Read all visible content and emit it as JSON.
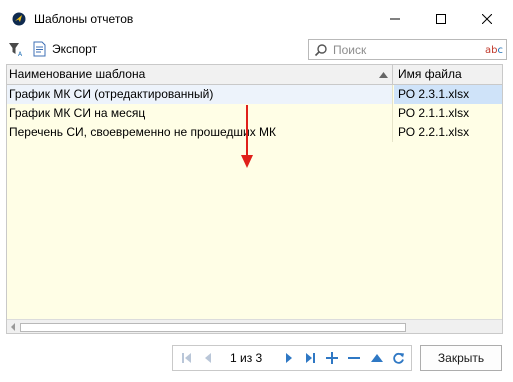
{
  "window": {
    "title": "Шаблоны отчетов"
  },
  "toolbar": {
    "export_label": "Экспорт",
    "search_placeholder": "Поиск",
    "search_mode_label": "abc"
  },
  "grid": {
    "columns": [
      "Наименование шаблона",
      "Имя файла"
    ],
    "rows": [
      {
        "name": "График МК СИ (отредактированный)",
        "file": "РО 2.3.1.xlsx",
        "selected": true
      },
      {
        "name": "График МК СИ на месяц",
        "file": "РО 2.1.1.xlsx",
        "selected": false
      },
      {
        "name": "Перечень СИ, своевременно не прошедших МК",
        "file": "РО 2.2.1.xlsx",
        "selected": false
      }
    ],
    "sort_column": "Наименование шаблона",
    "sort_direction": "ascending"
  },
  "pager": {
    "page_text": "1 из 3"
  },
  "footer": {
    "close_label": "Закрыть"
  },
  "colors": {
    "grid_background": "#fffee6",
    "selected_cell": "#cfe3f9",
    "accent_blue": "#1f6fb5",
    "annotation_arrow": "#e0201a"
  },
  "icons": [
    "app-logo-icon",
    "minimize-icon",
    "maximize-icon",
    "close-icon",
    "filter-icon",
    "export-icon",
    "search-icon",
    "abc-icon",
    "sort-asc-icon",
    "first-page-icon",
    "prev-page-icon",
    "next-page-icon",
    "last-page-icon",
    "add-icon",
    "remove-icon",
    "up-icon",
    "refresh-icon"
  ]
}
